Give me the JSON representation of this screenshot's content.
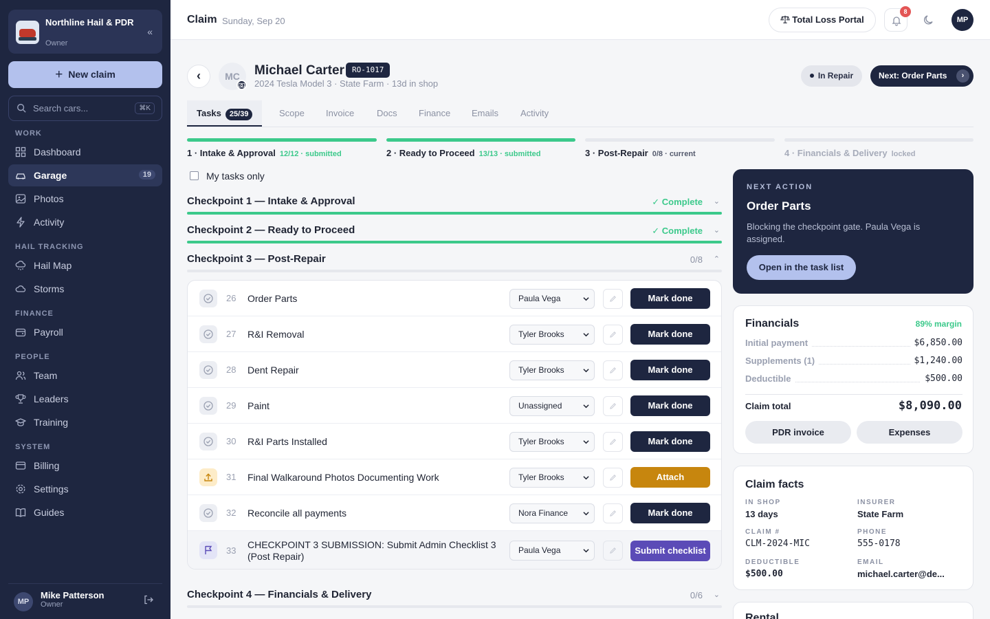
{
  "sidebar": {
    "org_name": "Northline Hail & PDR",
    "org_role": "Owner",
    "new_claim": "New claim",
    "search_placeholder": "Search cars...",
    "search_shortcut": "⌘K",
    "sections": {
      "work": "WORK",
      "hail": "HAIL TRACKING",
      "finance": "FINANCE",
      "people": "PEOPLE",
      "system": "SYSTEM"
    },
    "items": [
      {
        "label": "Dashboard"
      },
      {
        "label": "Garage",
        "badge": "19"
      },
      {
        "label": "Photos"
      },
      {
        "label": "Activity"
      },
      {
        "label": "Hail Map"
      },
      {
        "label": "Storms"
      },
      {
        "label": "Payroll"
      },
      {
        "label": "Team"
      },
      {
        "label": "Leaders"
      },
      {
        "label": "Training"
      },
      {
        "label": "Billing"
      },
      {
        "label": "Settings"
      },
      {
        "label": "Guides"
      }
    ],
    "user": {
      "initials": "MP",
      "name": "Mike Patterson",
      "role": "Owner"
    }
  },
  "topbar": {
    "title": "Claim",
    "date": "Sunday, Sep 20",
    "portal": "Total Loss Portal",
    "notifications": "8",
    "user_initials": "MP"
  },
  "claim": {
    "initials": "MC",
    "name": "Michael Carter",
    "ro": "RO-1017",
    "subtitle": "2024 Tesla Model 3 · State Farm · 13d in shop",
    "status": "In Repair",
    "next": "Next: Order Parts"
  },
  "tabs": [
    {
      "label": "Tasks",
      "count": "25/39"
    },
    {
      "label": "Scope"
    },
    {
      "label": "Invoice"
    },
    {
      "label": "Docs"
    },
    {
      "label": "Finance"
    },
    {
      "label": "Emails"
    },
    {
      "label": "Activity"
    }
  ],
  "checkpoints": [
    {
      "label": "1 · Intake & Approval",
      "status": "12/12 · submitted",
      "progress": 1.0
    },
    {
      "label": "2 · Ready to Proceed",
      "status": "13/13 · submitted",
      "progress": 1.0
    },
    {
      "label": "3 · Post-Repair",
      "status": "0/8 · current",
      "progress": 0.0
    },
    {
      "label": "4 · Financials & Delivery",
      "status": "locked",
      "progress": 0.0
    }
  ],
  "my_tasks_only": "My tasks only",
  "sections": [
    {
      "title": "Checkpoint 1 — Intake & Approval",
      "status": "✓ Complete"
    },
    {
      "title": "Checkpoint 2 — Ready to Proceed",
      "status": "✓ Complete"
    },
    {
      "title": "Checkpoint 3 — Post-Repair",
      "status": "0/8"
    },
    {
      "title": "Checkpoint 4 — Financials & Delivery",
      "status": "0/6"
    }
  ],
  "tasks": [
    {
      "num": "26",
      "title": "Order Parts",
      "assignee": "Paula Vega",
      "action": "Mark done"
    },
    {
      "num": "27",
      "title": "R&I Removal",
      "assignee": "Tyler Brooks",
      "action": "Mark done"
    },
    {
      "num": "28",
      "title": "Dent Repair",
      "assignee": "Tyler Brooks",
      "action": "Mark done"
    },
    {
      "num": "29",
      "title": "Paint",
      "assignee": "Unassigned",
      "action": "Mark done"
    },
    {
      "num": "30",
      "title": "R&I Parts Installed",
      "assignee": "Tyler Brooks",
      "action": "Mark done"
    },
    {
      "num": "31",
      "title": "Final Walkaround Photos Documenting Work",
      "assignee": "Tyler Brooks",
      "action": "Attach"
    },
    {
      "num": "32",
      "title": "Reconcile all payments",
      "assignee": "Nora Finance",
      "action": "Mark done"
    },
    {
      "num": "33",
      "title": "CHECKPOINT 3 SUBMISSION: Submit Admin Checklist 3 (Post Repair)",
      "assignee": "Paula Vega",
      "action": "Submit checklist"
    }
  ],
  "next_action": {
    "kicker": "NEXT ACTION",
    "title": "Order Parts",
    "desc": "Blocking the checkpoint gate. Paula Vega is assigned.",
    "button": "Open in the task list"
  },
  "financials": {
    "title": "Financials",
    "margin": "89% margin",
    "lines": [
      {
        "label": "Initial payment",
        "value": "$6,850.00"
      },
      {
        "label": "Supplements (1)",
        "value": "$1,240.00"
      },
      {
        "label": "Deductible",
        "value": "$500.00"
      }
    ],
    "total_label": "Claim total",
    "total_value": "$8,090.00",
    "btn_invoice": "PDR invoice",
    "btn_expenses": "Expenses"
  },
  "facts": {
    "title": "Claim facts",
    "in_shop_k": "IN SHOP",
    "in_shop_v": "13 days",
    "insurer_k": "INSURER",
    "insurer_v": "State Farm",
    "claim_k": "CLAIM #",
    "claim_v": "CLM-2024-MIC",
    "phone_k": "PHONE",
    "phone_v": "555-0178",
    "deductible_k": "DEDUCTIBLE",
    "deductible_v": "$500.00",
    "email_k": "EMAIL",
    "email_v": "michael.carter@de..."
  },
  "rental": {
    "title": "Rental"
  },
  "colors": {
    "sidebar": "#1e2640",
    "accent": "#b3c1ed",
    "success": "#3cc98b",
    "warning": "#c7860e",
    "submit": "#5b4bb7"
  }
}
